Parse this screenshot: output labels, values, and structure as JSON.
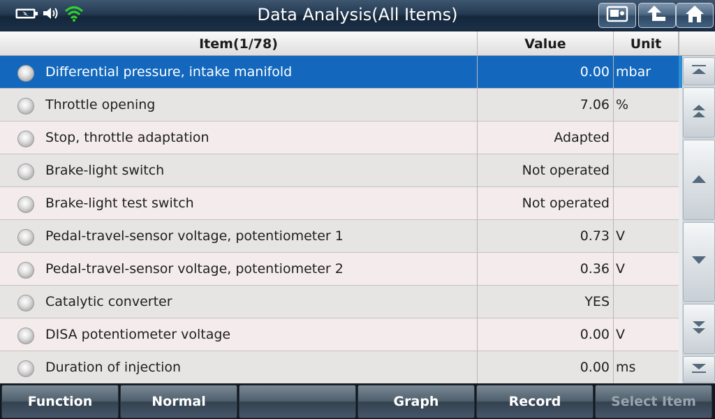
{
  "header": {
    "title": "Data Analysis(All Items)"
  },
  "status_icons": [
    "battery-icon",
    "speaker-icon",
    "wifi-icon"
  ],
  "toolbar_icons": [
    "screenshot-icon",
    "back-arrow-icon",
    "home-icon"
  ],
  "table": {
    "columns": [
      "Item(1/78)",
      "Value",
      "Unit"
    ],
    "rows": [
      {
        "item": "Differential pressure, intake manifold",
        "value": "0.00",
        "unit": "mbar"
      },
      {
        "item": "Throttle opening",
        "value": "7.06",
        "unit": "%"
      },
      {
        "item": "Stop, throttle adaptation",
        "value": "Adapted",
        "unit": ""
      },
      {
        "item": "Brake-light switch",
        "value": "Not operated",
        "unit": ""
      },
      {
        "item": "Brake-light test switch",
        "value": "Not operated",
        "unit": ""
      },
      {
        "item": "Pedal-travel-sensor voltage, potentiometer 1",
        "value": "0.73",
        "unit": "V"
      },
      {
        "item": "Pedal-travel-sensor voltage, potentiometer 2",
        "value": "0.36",
        "unit": "V"
      },
      {
        "item": "Catalytic converter",
        "value": "YES",
        "unit": ""
      },
      {
        "item": "DISA potentiometer voltage",
        "value": "0.00",
        "unit": "V"
      },
      {
        "item": "Duration of injection",
        "value": "0.00",
        "unit": "ms"
      }
    ]
  },
  "bottom_buttons": [
    {
      "label": "Function"
    },
    {
      "label": "Normal"
    },
    {
      "label": ""
    },
    {
      "label": "Graph"
    },
    {
      "label": "Record"
    },
    {
      "label": "Select Item"
    }
  ],
  "colors": {
    "selected_row": "#1368be",
    "wifi": "#2fd12f",
    "scroll_thumb": "#2c8fd6"
  }
}
